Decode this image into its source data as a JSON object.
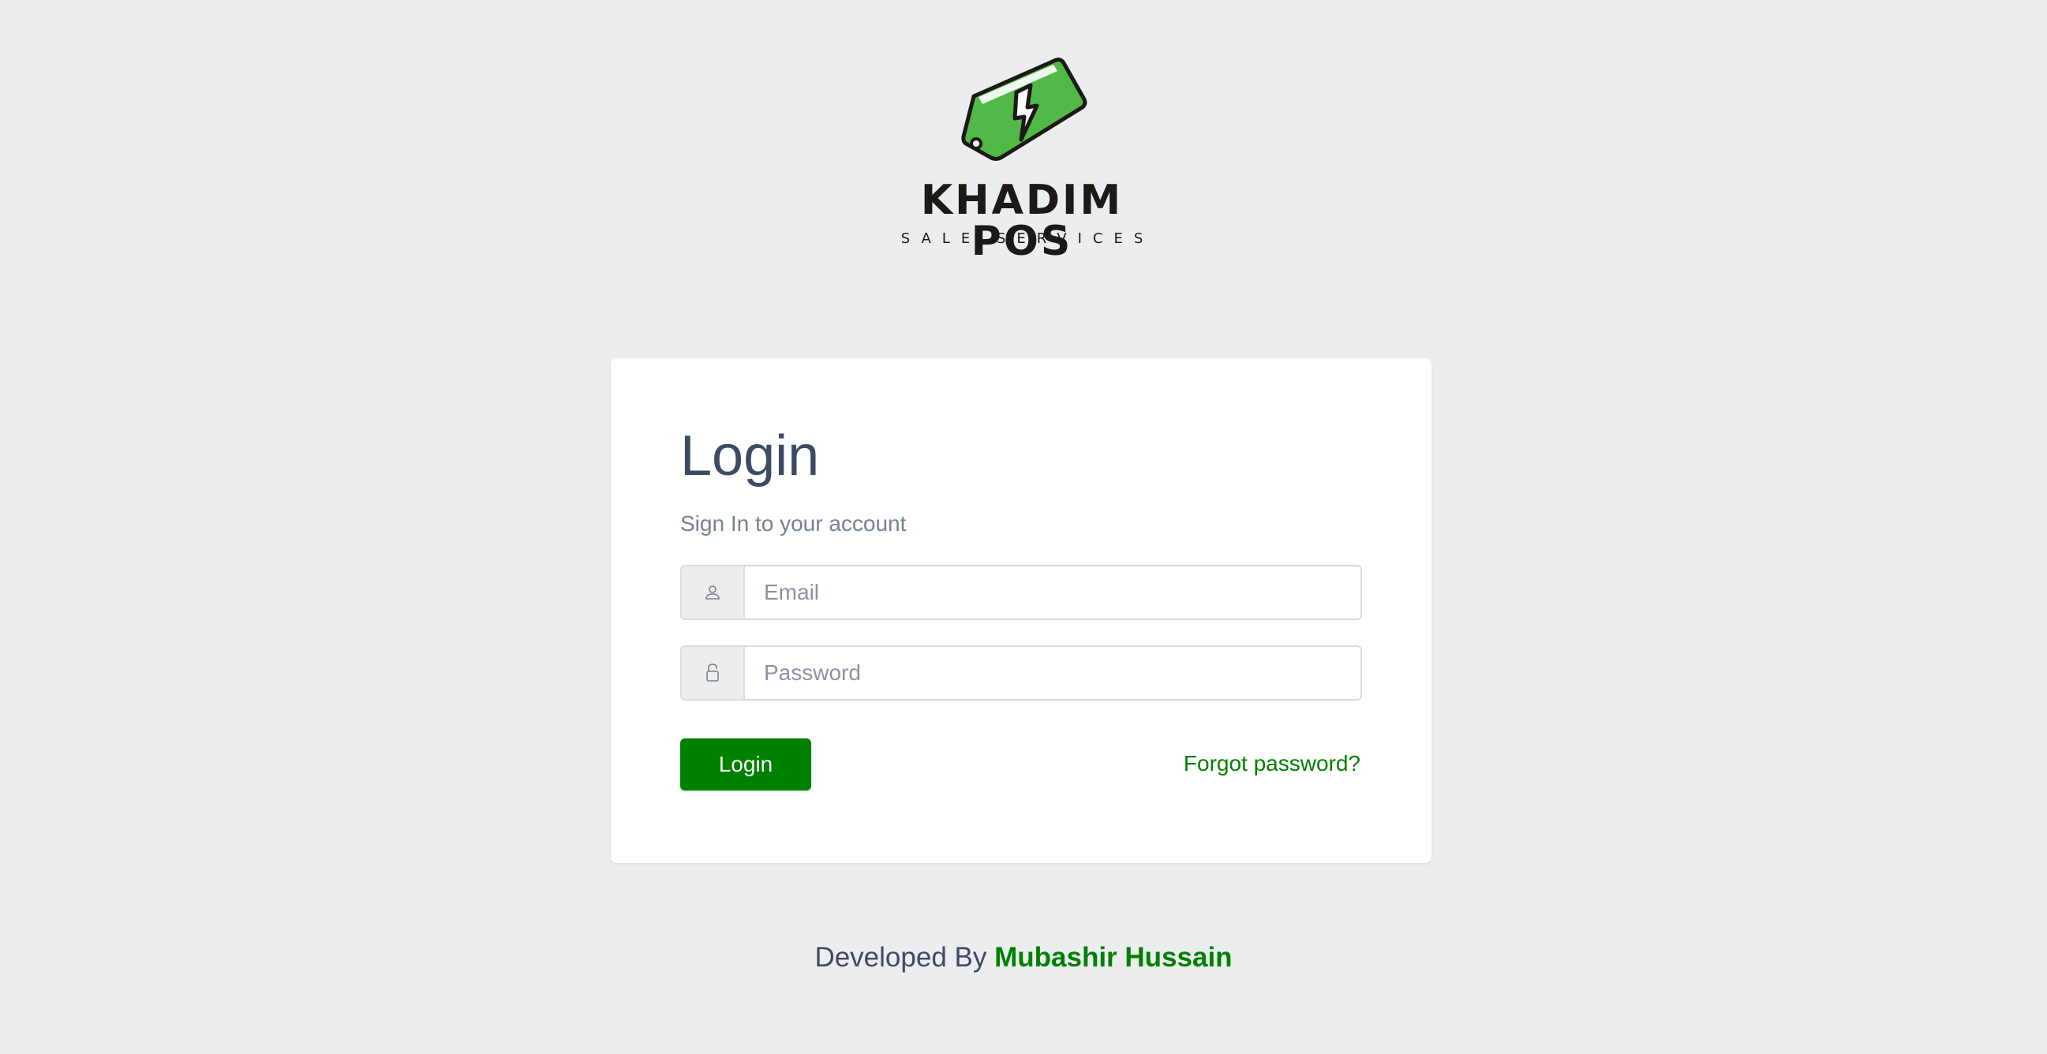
{
  "brand": {
    "name": "KHADIM POS",
    "tagline": "SALE SERVICES",
    "logo_icon": "price-tag-lightning-icon",
    "colors": {
      "tag_green": "#52b848",
      "outline": "#1c1917"
    }
  },
  "login_card": {
    "title": "Login",
    "subtitle": "Sign In to your account",
    "email": {
      "icon": "user-icon",
      "placeholder": "Email",
      "value": ""
    },
    "password": {
      "icon": "lock-icon",
      "placeholder": "Password",
      "value": ""
    },
    "login_button_label": "Login",
    "forgot_password_label": "Forgot password?"
  },
  "footer": {
    "prefix": "Developed By",
    "developer_name": "Mubashir Hussain"
  },
  "colors": {
    "background": "#ebedef",
    "accent": "#008000",
    "text": "#3c4b64",
    "muted": "#768192"
  }
}
